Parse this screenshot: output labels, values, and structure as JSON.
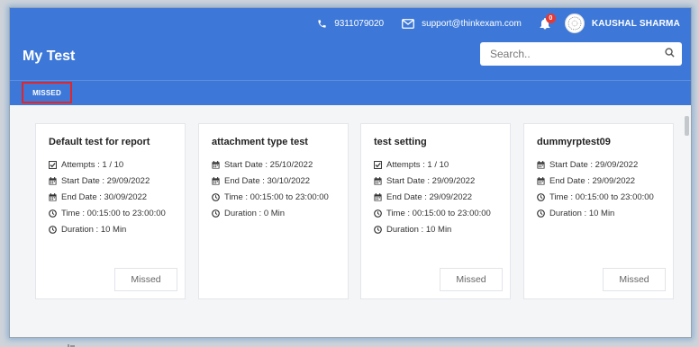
{
  "header": {
    "phone": "9311079020",
    "email": "support@thinkexam.com",
    "notification_count": "0",
    "user_name": "KAUSHAL SHARMA",
    "page_title": "My Test"
  },
  "search": {
    "placeholder": "Search.."
  },
  "tabs": {
    "active": "MISSED"
  },
  "colors": {
    "header": "#3d78d8",
    "highlight": "#e0262b"
  },
  "cards": [
    {
      "title": "Default test for report",
      "lines": [
        {
          "icon": "checkbox-icon",
          "text": "Attempts : 1 / 10"
        },
        {
          "icon": "calendar-icon",
          "text": "Start Date : 29/09/2022"
        },
        {
          "icon": "calendar-icon",
          "text": "End Date : 30/09/2022"
        },
        {
          "icon": "clock-icon",
          "text": "Time : 00:15:00 to 23:00:00"
        },
        {
          "icon": "clock-icon",
          "text": "Duration : 10 Min"
        }
      ],
      "status": "Missed"
    },
    {
      "title": "attachment type test",
      "lines": [
        {
          "icon": "calendar-icon",
          "text": "Start Date : 25/10/2022"
        },
        {
          "icon": "calendar-icon",
          "text": "End Date : 30/10/2022"
        },
        {
          "icon": "clock-icon",
          "text": "Time : 00:15:00 to 23:00:00"
        },
        {
          "icon": "clock-icon",
          "text": "Duration : 0 Min"
        }
      ],
      "status": ""
    },
    {
      "title": "test setting",
      "lines": [
        {
          "icon": "checkbox-icon",
          "text": "Attempts : 1 / 10"
        },
        {
          "icon": "calendar-icon",
          "text": "Start Date : 29/09/2022"
        },
        {
          "icon": "calendar-icon",
          "text": "End Date : 29/09/2022"
        },
        {
          "icon": "clock-icon",
          "text": "Time : 00:15:00 to 23:00:00"
        },
        {
          "icon": "clock-icon",
          "text": "Duration : 10 Min"
        }
      ],
      "status": "Missed"
    },
    {
      "title": "dummyrptest09",
      "lines": [
        {
          "icon": "calendar-icon",
          "text": "Start Date : 29/09/2022"
        },
        {
          "icon": "calendar-icon",
          "text": "End Date : 29/09/2022"
        },
        {
          "icon": "clock-icon",
          "text": "Time : 00:15:00 to 23:00:00"
        },
        {
          "icon": "clock-icon",
          "text": "Duration : 10 Min"
        }
      ],
      "status": "Missed"
    }
  ]
}
